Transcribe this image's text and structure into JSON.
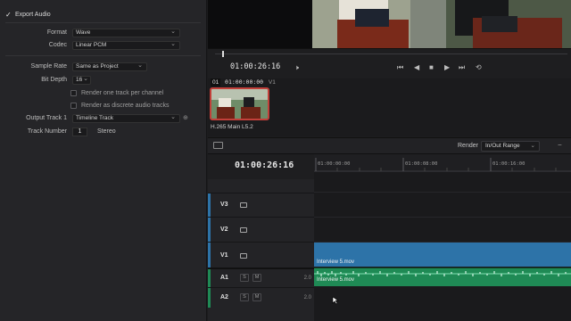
{
  "render_settings": {
    "export_audio_label": "Export Audio",
    "format_label": "Format",
    "format_value": "Wave",
    "codec_label": "Codec",
    "codec_value": "Linear PCM",
    "sample_rate_label": "Sample Rate",
    "sample_rate_value": "Same as Project",
    "bit_depth_label": "Bit Depth",
    "bit_depth_value": "16",
    "one_track_label": "Render one track per channel",
    "discrete_tracks_label": "Render as discrete audio tracks",
    "output_track_label": "Output Track 1",
    "output_track_value": "Timeline Track",
    "track_number_label": "Track Number",
    "track_number_value": "1",
    "stereo_label": "Stereo"
  },
  "viewer": {
    "timecode": "01:00:26:16"
  },
  "clips": {
    "index": "01",
    "timecode": "01:00:00:00",
    "track": "V1",
    "codec_label": "H.265 Main L5.2"
  },
  "timeline_toolbar": {
    "render_label": "Render",
    "render_range": "In/Out Range"
  },
  "timeline": {
    "timecode": "01:00:26:16",
    "ruler_ticks": [
      "01:00:00:00",
      "01:00:08:00",
      "01:00:16:00"
    ],
    "tracks": [
      {
        "name": "V3",
        "kind": "video"
      },
      {
        "name": "V2",
        "kind": "video"
      },
      {
        "name": "V1",
        "kind": "video"
      },
      {
        "name": "A1",
        "kind": "audio",
        "volume": "2.0"
      },
      {
        "name": "A2",
        "kind": "audio",
        "volume": "2.0"
      }
    ],
    "solo_label": "S",
    "mute_label": "M",
    "video_clip_name": "Interview 5.mov",
    "audio_clip_name": "Interview 5.mov"
  },
  "colors": {
    "accent_blue": "#2d73a8",
    "audio_green": "#1f8a55",
    "clip_selected_red": "#c2403a"
  }
}
